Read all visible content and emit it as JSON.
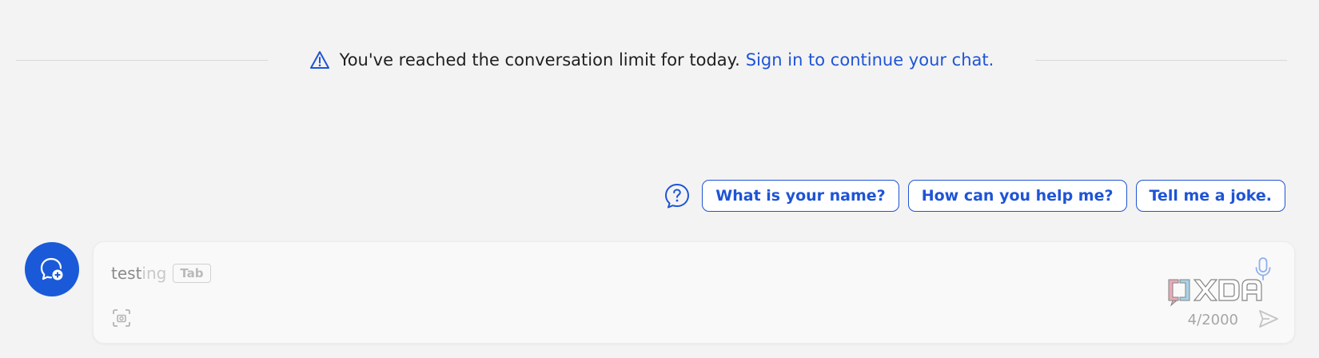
{
  "notice": {
    "message": "You've reached the conversation limit for today.",
    "link_text": "Sign in to continue your chat.",
    "icon": "warning-icon"
  },
  "suggestions": {
    "icon": "question-icon",
    "chips": [
      {
        "label": "What is your name?"
      },
      {
        "label": "How can you help me?"
      },
      {
        "label": "Tell me a joke."
      }
    ]
  },
  "new_chat": {
    "icon": "new-chat-icon"
  },
  "composer": {
    "typed_text": "test",
    "autocomplete_hint": "ing",
    "tab_key_label": "Tab",
    "counter": "4/2000",
    "icons": {
      "mic": "microphone-icon",
      "screenshot": "screenshot-icon",
      "send": "send-icon"
    }
  },
  "watermark": {
    "text": "XDA"
  },
  "colors": {
    "accent": "#1e54d6",
    "background": "#f3f3f3",
    "new_chat_button": "#1a5ad9"
  }
}
